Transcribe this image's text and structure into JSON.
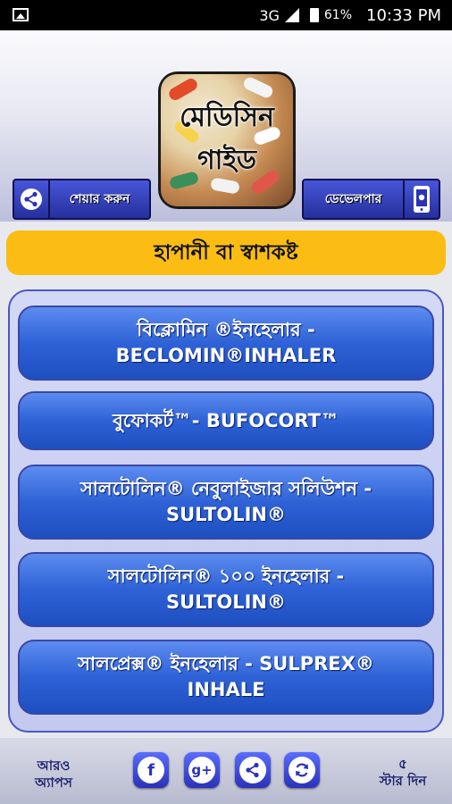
{
  "status_bar": {
    "network": "3G",
    "battery": "61%",
    "time": "10:33 PM"
  },
  "header": {
    "logo_line1": "মেডিসিন",
    "logo_line2": "গাইড",
    "share_label": "শেয়ার করুন",
    "developer_label": "ডেভেলপার"
  },
  "category": {
    "title": "হাপানী বা স্বাশকষ্ট"
  },
  "medicines": [
    {
      "line1": "বিক্লোমিন ®ইনহেলার -",
      "line2": "BECLOMIN®INHALER"
    },
    {
      "line1": "বুফোকর্ট™- BUFOCORT™",
      "line2": ""
    },
    {
      "line1": "সালটোলিন® নেবুলাইজার সলিউশন -",
      "line2": "SULTOLIN®"
    },
    {
      "line1": "সালটোলিন® ১০০ ইনহেলার -",
      "line2": "SULTOLIN®"
    },
    {
      "line1": "সালপ্রেক্স® ইনহেলার - SULPREX®",
      "line2": "INHALE"
    }
  ],
  "footer": {
    "more_apps_line1": "আরও",
    "more_apps_line2": "অ্যাপস",
    "facebook_glyph": "f",
    "gplus_glyph": "g+",
    "rate_line1": "৫",
    "rate_line2": "স্টার দিন"
  }
}
